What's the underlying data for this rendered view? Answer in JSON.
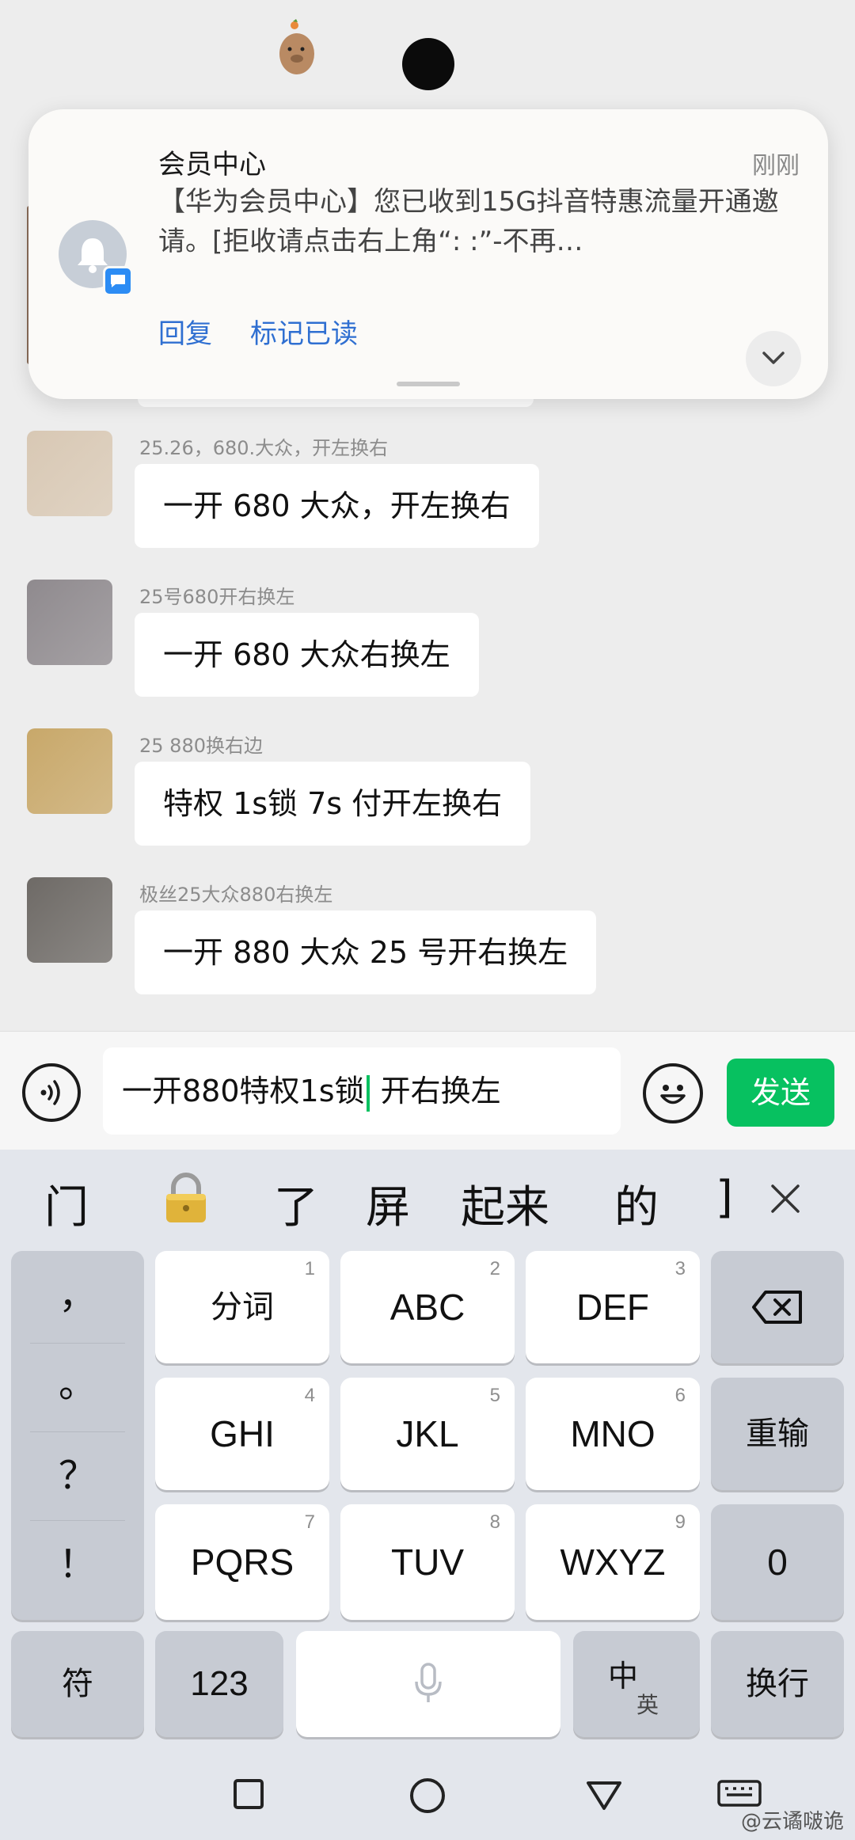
{
  "notification": {
    "app_name": "会员中心",
    "time": "刚刚",
    "body": "【华为会员中心】您已收到15G抖音特惠流量开通邀请。[拒收请点击右上角“: :”-不再…",
    "actions": {
      "reply": "回复",
      "mark_read": "标记已读"
    }
  },
  "messages": [
    {
      "nickname": "25.26，680.大众，开左换右",
      "text": "一开 680 大众，开左换右",
      "avatar_color": "#d8c8b4"
    },
    {
      "nickname": "25号680开右换左",
      "text": "一开 680 大众右换左",
      "avatar_color": "#8f8a8e"
    },
    {
      "nickname": "25 880换右边",
      "text": "特权 1s锁 7s 付开左换右",
      "avatar_color": "#c8a86a"
    },
    {
      "nickname": "极丝25大众880右换左",
      "text": "一开 880 大众 25 号开右换左",
      "avatar_color": "#6e6a66"
    }
  ],
  "input": {
    "before_caret": "一开880特权1s锁",
    "after_caret": " 开右换左",
    "send_label": "发送"
  },
  "keyboard": {
    "candidates": [
      "门",
      "了",
      "屏",
      "起来",
      "的",
      "]"
    ],
    "punctuation": [
      "，",
      "。",
      "？",
      "！"
    ],
    "keys": [
      {
        "label": "分词",
        "num": "1"
      },
      {
        "label": "ABC",
        "num": "2"
      },
      {
        "label": "DEF",
        "num": "3"
      },
      {
        "label": "GHI",
        "num": "4"
      },
      {
        "label": "JKL",
        "num": "5"
      },
      {
        "label": "MNO",
        "num": "6"
      },
      {
        "label": "PQRS",
        "num": "7"
      },
      {
        "label": "TUV",
        "num": "8"
      },
      {
        "label": "WXYZ",
        "num": "9"
      }
    ],
    "reenter": "重输",
    "zero": "0",
    "symbols": "符",
    "numbers": "123",
    "lang_main": "中",
    "lang_sub": "英",
    "newline": "换行"
  },
  "watermark": "@云谲啵诡",
  "colors": {
    "send_green": "#07c160",
    "action_blue": "#2f6fd1",
    "chat_bg": "#ededed"
  }
}
